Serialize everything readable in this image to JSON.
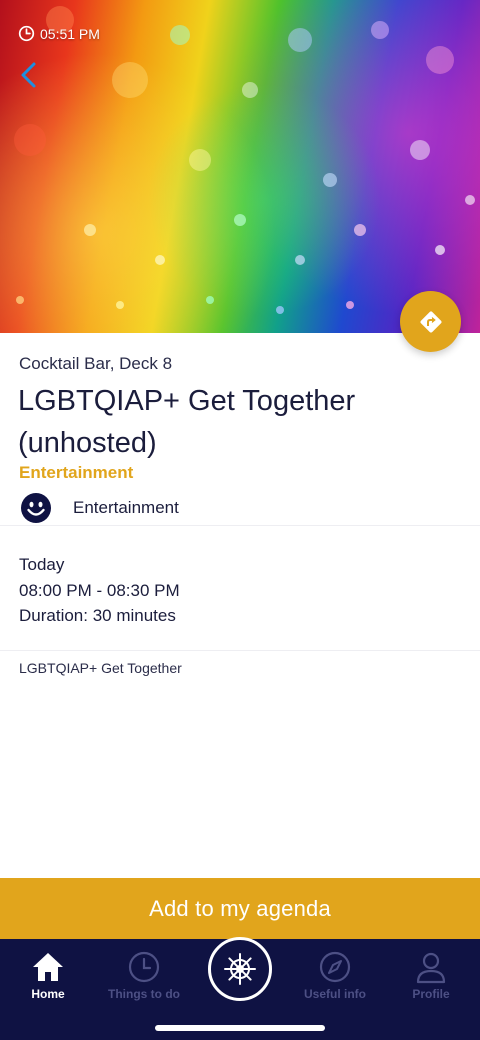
{
  "status_bar": {
    "time": "05:51 PM"
  },
  "event": {
    "location": "Cocktail Bar, Deck 8",
    "title_line1": "LGBTQIAP+ Get Together",
    "title_line2": "(unhosted)",
    "category": "Entertainment",
    "tag_label": "Entertainment",
    "day": "Today",
    "time_range": "08:00 PM - 08:30 PM",
    "duration": "Duration: 30 minutes",
    "description": "LGBTQIAP+ Get Together"
  },
  "actions": {
    "add_label": "Add to my agenda"
  },
  "tabs": [
    {
      "label": "Home",
      "icon": "home-icon",
      "active": true
    },
    {
      "label": "Things to do",
      "icon": "clock-icon",
      "active": false
    },
    {
      "label": "",
      "icon": "ship-wheel-icon",
      "active": false
    },
    {
      "label": "Useful info",
      "icon": "compass-icon",
      "active": false
    },
    {
      "label": "Profile",
      "icon": "profile-icon",
      "active": false
    }
  ],
  "icons": {
    "status_clock": "clock-icon",
    "back": "chevron-left-icon",
    "directions": "directions-icon",
    "tag": "smiley-icon"
  },
  "colors": {
    "accent": "#e1a51c",
    "navy": "#0f1243",
    "back_arrow": "#1e8fe0",
    "text": "#1b1d3c",
    "inactive_tab": "#4d5085"
  }
}
